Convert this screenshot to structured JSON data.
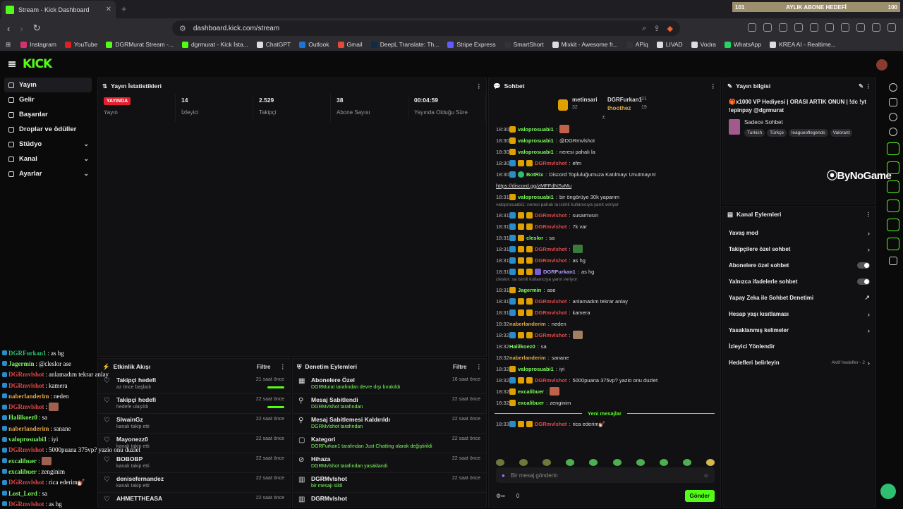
{
  "browser": {
    "tab_title": "Stream - Kick Dashboard",
    "url": "dashboard.kick.com/stream",
    "goal_label": "AYLIK ABONE HEDEFİ",
    "goal_current": "101",
    "goal_target": "100"
  },
  "bookmarks": [
    {
      "label": "Instagram",
      "color": "#d6336c"
    },
    {
      "label": "YouTube",
      "color": "#e02020"
    },
    {
      "label": "DGRMurat Stream -...",
      "color": "#53fc18"
    },
    {
      "label": "dgrmurat - Kick İsta...",
      "color": "#53fc18"
    },
    {
      "label": "ChatGPT",
      "color": "#dddddd"
    },
    {
      "label": "Outlook",
      "color": "#1e74d6"
    },
    {
      "label": "Gmail",
      "color": "#e04b3a"
    },
    {
      "label": "DeepL Translate: Th...",
      "color": "#0f2b46"
    },
    {
      "label": "Stripe Express",
      "color": "#635bff"
    },
    {
      "label": "SmartShort",
      "color": "#333333"
    },
    {
      "label": "Mixkit - Awesome fr...",
      "color": "#dddddd"
    },
    {
      "label": "APiq",
      "color": "#333333"
    },
    {
      "label": "LIVAD",
      "color": "#dddddd"
    },
    {
      "label": "Vodra",
      "color": "#dddddd"
    },
    {
      "label": "WhatsApp",
      "color": "#25d366"
    },
    {
      "label": "KREA AI - Realtime...",
      "color": "#dddddd"
    }
  ],
  "app": {
    "logo": "KICK"
  },
  "sidebar": {
    "items": [
      {
        "label": "Yayın",
        "chev": ""
      },
      {
        "label": "Gelir",
        "chev": ""
      },
      {
        "label": "Başarılar",
        "chev": ""
      },
      {
        "label": "Droplar ve ödüller",
        "chev": ""
      },
      {
        "label": "Stüdyo",
        "chev": "⌄"
      },
      {
        "label": "Kanal",
        "chev": "⌄"
      },
      {
        "label": "Ayarlar",
        "chev": "⌄"
      }
    ]
  },
  "stats": {
    "title": "Yayın İstatistikleri",
    "live": "YAYINDA",
    "items": [
      {
        "v": "",
        "l": "Yayın"
      },
      {
        "v": "14",
        "l": "İzleyici"
      },
      {
        "v": "2.529",
        "l": "Takipçi"
      },
      {
        "v": "38",
        "l": "Abone Sayısı"
      },
      {
        "v": "00:04:59",
        "l": "Yayında Olduğu Süre"
      }
    ]
  },
  "activity": {
    "title": "Etkinlik Akışı",
    "filter": "Filtre",
    "rows": [
      {
        "t": "Takipçi hedefi",
        "s": "az önce başladı",
        "tm": "21 saat önce",
        "bar": true
      },
      {
        "t": "Takipçi hedefi",
        "s": "hedefe ulaşıldı",
        "tm": "22 saat önce",
        "bar": true
      },
      {
        "t": "SlwainGz",
        "s": "kanalı takip etti",
        "tm": "22 saat önce",
        "bar": false
      },
      {
        "t": "Mayonezz0",
        "s": "kanalı takip etti",
        "tm": "22 saat önce",
        "bar": false
      },
      {
        "t": "BOBOBP",
        "s": "kanalı takip etti",
        "tm": "22 saat önce",
        "bar": false
      },
      {
        "t": "denisefernandez",
        "s": "kanalı takip etti",
        "tm": "22 saat önce",
        "bar": false
      },
      {
        "t": "AHMETTHEASA",
        "s": "",
        "tm": "22 saat önce",
        "bar": false
      }
    ]
  },
  "moderation": {
    "title": "Denetim Eylemleri",
    "filter": "Filtre",
    "rows": [
      {
        "t": "Abonelere Özel",
        "s": "DGRMurat tarafından devre dışı bırakıldı",
        "tm": "16 saat önce",
        "icon": "▦"
      },
      {
        "t": "Mesaj Sabitlendi",
        "s": "DGRMvlshot tarafından",
        "tm": "22 saat önce",
        "icon": "⚲"
      },
      {
        "t": "Mesaj Sabitlemesi Kaldırıldı",
        "s": "DGRMvlshot tarafından",
        "tm": "22 saat önce",
        "icon": "⚲"
      },
      {
        "t": "Kategori",
        "s": "DGRFurkan1 tarafından Just Chatting olarak değiştirildi",
        "tm": "22 saat önce",
        "icon": "▢"
      },
      {
        "t": "Hihaza",
        "s": "DGRMvlshot tarafından yasaklandı",
        "tm": "22 saat önce",
        "icon": "⊘"
      },
      {
        "t": "DGRMvlshot",
        "s": "bir mesajı sildi",
        "tm": "22 saat önce",
        "icon": "▥"
      },
      {
        "t": "DGRMvlshot",
        "s": "",
        "tm": "",
        "icon": "▥"
      }
    ]
  },
  "chat": {
    "title": "Sohbet",
    "top": [
      {
        "name": "metinsari",
        "n": "32"
      },
      {
        "name": "DGRFurkan1",
        "n": "21"
      },
      {
        "name": "thoothez",
        "n": "19"
      }
    ],
    "messages": [
      {
        "tm": "18:30",
        "badges": [
          "sub"
        ],
        "user": "valoprosuabi1",
        "color": "#7cfc5c",
        "text": "",
        "emo": "#c0624a"
      },
      {
        "tm": "18:30",
        "badges": [
          "sub"
        ],
        "user": "valoprosuabi1",
        "color": "#7cfc5c",
        "text": "@DGRmvlshot",
        "emo": ""
      },
      {
        "tm": "18:30",
        "badges": [
          "sub"
        ],
        "user": "valoprosuabi1",
        "color": "#7cfc5c",
        "text": "neresi pahalı la",
        "emo": ""
      },
      {
        "tm": "18:30",
        "badges": [
          "mod",
          "sub",
          "sub"
        ],
        "user": "DGRmvlshot",
        "color": "#e34949",
        "text": "efm",
        "emo": ""
      },
      {
        "tm": "18:30",
        "badges": [
          "mod",
          "bot"
        ],
        "user": "BotRix",
        "color": "#7cfc5c",
        "text": "Discord Topluluğumuza Katılmayı Unutmayın!",
        "emo": ""
      },
      {
        "tm": "",
        "badges": [],
        "user": "",
        "color": "#ddd",
        "text": "https://discord.gg/zMFFdNSvMu",
        "emo": ""
      },
      {
        "tm": "18:31",
        "badges": [
          "sub"
        ],
        "user": "valoprosuabi1",
        "color": "#7cfc5c",
        "text": "bir öngörüye 30k yaparım",
        "emo": ""
      },
      {
        "reply": "valoprosuabi1: neresi pahalı la isimli kullanıcıya yanıt veriyor"
      },
      {
        "tm": "18:31",
        "badges": [
          "mod",
          "sub",
          "sub"
        ],
        "user": "DGRmvlshot",
        "color": "#e34949",
        "text": "susarmısın",
        "emo": ""
      },
      {
        "tm": "18:31",
        "badges": [
          "mod",
          "sub",
          "sub"
        ],
        "user": "DGRmvlshot",
        "color": "#e34949",
        "text": "7k var",
        "emo": ""
      },
      {
        "tm": "18:31",
        "badges": [
          "mod",
          "sub"
        ],
        "user": "cleslor",
        "color": "#7cfc5c",
        "text": "sa",
        "emo": ""
      },
      {
        "tm": "18:31",
        "badges": [
          "mod",
          "sub",
          "sub"
        ],
        "user": "DGRmvlshot",
        "color": "#e34949",
        "text": "",
        "emo": "#3a7a3a"
      },
      {
        "tm": "18:31",
        "badges": [
          "mod",
          "sub",
          "sub"
        ],
        "user": "DGRmvlshot",
        "color": "#e34949",
        "text": "as hg",
        "emo": ""
      },
      {
        "tm": "18:31",
        "badges": [
          "mod",
          "sub",
          "sub",
          "ver"
        ],
        "user": "DGRFurkan1",
        "color": "#b49cff",
        "text": "as hg",
        "emo": ""
      },
      {
        "reply": "cleslor: sa isimli kullanıcıya yanıt veriyor"
      },
      {
        "tm": "18:31",
        "badges": [
          "sub"
        ],
        "user": "Jagermin",
        "color": "#7cfc5c",
        "text": "ase",
        "emo": ""
      },
      {
        "tm": "18:31",
        "badges": [
          "mod",
          "sub",
          "sub"
        ],
        "user": "DGRmvlshot",
        "color": "#e34949",
        "text": "anlamadım tekrar anlay",
        "emo": ""
      },
      {
        "tm": "18:31",
        "badges": [
          "mod",
          "sub",
          "sub"
        ],
        "user": "DGRmvlshot",
        "color": "#e34949",
        "text": "kamera",
        "emo": ""
      },
      {
        "tm": "18:32",
        "badges": [],
        "user": "naberlanderim",
        "color": "#e0a84a",
        "text": "neden",
        "emo": ""
      },
      {
        "tm": "18:32",
        "badges": [
          "mod",
          "sub",
          "sub"
        ],
        "user": "DGRmvlshot",
        "color": "#e34949",
        "text": "",
        "emo": "#a08060"
      },
      {
        "tm": "18:32",
        "badges": [],
        "user": "Halilkoez0",
        "color": "#7cfc5c",
        "text": "sa",
        "emo": ""
      },
      {
        "tm": "18:32",
        "badges": [],
        "user": "naberlanderim",
        "color": "#e0a84a",
        "text": "sanane",
        "emo": ""
      },
      {
        "tm": "18:32",
        "badges": [
          "sub"
        ],
        "user": "valoprosuabi1",
        "color": "#7cfc5c",
        "text": "iyi",
        "emo": ""
      },
      {
        "tm": "18:32",
        "badges": [
          "mod",
          "sub",
          "sub"
        ],
        "user": "DGRmvlshot",
        "color": "#e34949",
        "text": "5000puana 375vp? yazio onu duzlet",
        "emo": ""
      },
      {
        "tm": "18:32",
        "badges": [
          "sub"
        ],
        "user": "excalibuer",
        "color": "#7cfc5c",
        "text": "",
        "emo": "#c0624a"
      },
      {
        "tm": "18:32",
        "badges": [
          "sub"
        ],
        "user": "excalibuer",
        "color": "#7cfc5c",
        "text": "zenginim",
        "emo": ""
      }
    ],
    "new_label": "Yeni mesajlar",
    "new_messages": [
      {
        "tm": "18:33",
        "badges": [
          "mod",
          "sub",
          "sub"
        ],
        "user": "DGRmvlshot",
        "color": "#e34949",
        "text": "rica ederim💅🏻",
        "emo": ""
      },
      {
        "tm": "18:33",
        "badges": [],
        "user": "Lost_Lord",
        "color": "#7cfc5c",
        "text": "sa",
        "emo": ""
      },
      {
        "tm": "18:33",
        "badges": [
          "mod",
          "sub",
          "sub"
        ],
        "user": "DGRmvlshot",
        "color": "#e34949",
        "text": "as hg",
        "emo": ""
      }
    ],
    "input_placeholder": "Bir mesaj gönderin",
    "points": "0",
    "send": "Gönder"
  },
  "info": {
    "title": "Yayın bilgisi",
    "stream_title": "🎁x1000 VP Hediyesi | ORASI ARTIK ONUN | !dc !yt !epinpay @dgrmurat",
    "category": "Sadece Sohbet",
    "tags": [
      "Turkish",
      "Türkçe",
      "leagueoflegends",
      "Valorant"
    ],
    "watermark": "ByNoGame"
  },
  "actions": {
    "title": "Kanal Eylemleri",
    "rows": [
      {
        "t": "Yavaş mod",
        "kind": "chev",
        "extra": ""
      },
      {
        "t": "Takipçilere özel sohbet",
        "kind": "chev",
        "extra": ""
      },
      {
        "t": "Abonelere özel sohbet",
        "kind": "toggle",
        "extra": ""
      },
      {
        "t": "Yalnızca ifadelerle sohbet",
        "kind": "toggle",
        "extra": ""
      },
      {
        "t": "Yapay Zeka ile Sohbet Denetimi",
        "kind": "ext",
        "extra": ""
      },
      {
        "t": "Hesap yaşı kısıtlaması",
        "kind": "chev",
        "extra": ""
      },
      {
        "t": "Yasaklanmış kelimeler",
        "kind": "chev",
        "extra": ""
      },
      {
        "t": "İzleyici Yönlendir",
        "kind": "none",
        "extra": ""
      },
      {
        "t": "Hedefleri belirleyin",
        "kind": "chev",
        "extra": "Aktif hedefler - 2"
      }
    ]
  },
  "overlay": [
    {
      "u": "DGRFurkan1",
      "c": "#2fbf71",
      "t": "as hg"
    },
    {
      "u": "Jagermin",
      "c": "#7cfc5c",
      "t": "@cleslor ase"
    },
    {
      "u": "DGRmvlshot",
      "c": "#e34949",
      "t": "anlamadım tekrar anlay"
    },
    {
      "u": "DGRmvlshot",
      "c": "#e34949",
      "t": "kamera"
    },
    {
      "u": "naberlanderim",
      "c": "#e0a84a",
      "t": "neden"
    },
    {
      "u": "DGRmvlshot",
      "c": "#e34949",
      "t": ""
    },
    {
      "u": "Halilkoez0",
      "c": "#7cfc5c",
      "t": "sa"
    },
    {
      "u": "naberlanderim",
      "c": "#e0a84a",
      "t": "sanane"
    },
    {
      "u": "valoprosuabi1",
      "c": "#7cfc5c",
      "t": "iyi"
    },
    {
      "u": "DGRmvlshot",
      "c": "#e34949",
      "t": "5000puana 375vp? yazio onu duzlet"
    },
    {
      "u": "excalibuer",
      "c": "#7cfc5c",
      "t": ""
    },
    {
      "u": "excalibuer",
      "c": "#7cfc5c",
      "t": "zenginim"
    },
    {
      "u": "DGRmvlshot",
      "c": "#e34949",
      "t": "rica ederim💅🏻"
    },
    {
      "u": "Lost_Lord",
      "c": "#7cfc5c",
      "t": "sa"
    },
    {
      "u": "DGRmvlshot",
      "c": "#e34949",
      "t": "as hg"
    }
  ]
}
